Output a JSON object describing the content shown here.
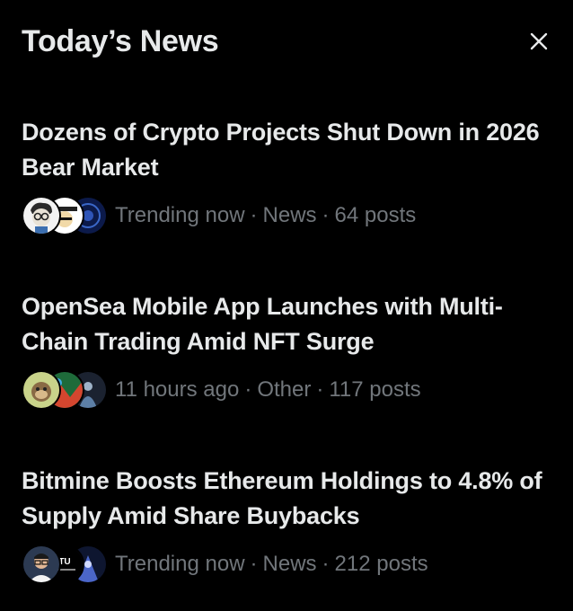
{
  "header": {
    "title": "Today’s News",
    "close_icon": "close-icon"
  },
  "items": [
    {
      "title": "Dozens of Crypto Projects Shut Down in 2026 Bear Market",
      "time": "Trending now",
      "category": "News",
      "posts": "64 posts",
      "avatars": [
        "avatar-cartoon-glasses",
        "avatar-cartoon-hat",
        "avatar-blue-emblem"
      ]
    },
    {
      "title": "OpenSea Mobile App Launches with Multi-Chain Trading Amid NFT Surge",
      "time": "11 hours ago",
      "category": "Other",
      "posts": "117 posts",
      "avatars": [
        "avatar-ape",
        "avatar-green-art",
        "avatar-dark-figure"
      ]
    },
    {
      "title": "Bitmine Boosts Ethereum Holdings to 4.8% of Supply Amid Share Buybacks",
      "time": "Trending now",
      "category": "News",
      "posts": "212 posts",
      "avatars": [
        "avatar-person-glasses",
        "avatar-logo-text",
        "avatar-blue-figure"
      ]
    }
  ],
  "separator": "·",
  "avatar_logo_text": "TU"
}
